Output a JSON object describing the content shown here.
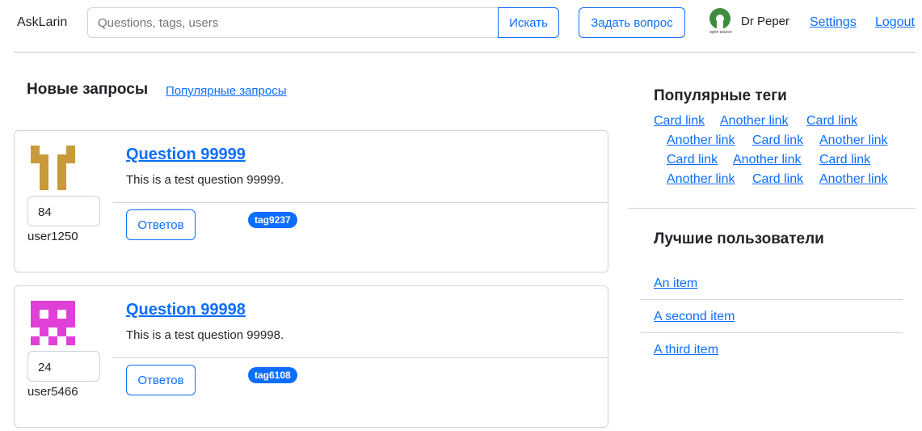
{
  "navbar": {
    "brand": "AskLarin",
    "search_placeholder": "Questions, tags, users",
    "search_button": "Искать",
    "ask_button": "Задать вопрос",
    "logo_caption": "open source",
    "username": "Dr Peper",
    "settings": "Settings",
    "logout": "Logout"
  },
  "main": {
    "title": "Новые запросы",
    "popular_link": "Популярные запросы",
    "questions": [
      {
        "title": "Question 99999",
        "text": "This is a test question 99999.",
        "rating": "84",
        "author": "user1250",
        "answers_label": "Ответов",
        "tag": "tag9237",
        "avatar_color": "#c89a3a"
      },
      {
        "title": "Question 99998",
        "text": "This is a test question 99998.",
        "rating": "24",
        "author": "user5466",
        "answers_label": "Ответов",
        "tag": "tag6108",
        "avatar_color": "#e040d8"
      }
    ]
  },
  "sidebar": {
    "tags_title": "Популярные теги",
    "tags": [
      "Card link",
      "Another link",
      "Card link",
      "Another link",
      "Card link",
      "Another link",
      "Card link",
      "Another link",
      "Card link",
      "Another link",
      "Card link",
      "Another link"
    ],
    "users_title": "Лучшие пользователи",
    "users": [
      "An item",
      "A second item",
      "A third item"
    ]
  },
  "colors": {
    "accent": "#0d6efd",
    "border": "#d3d3d3"
  }
}
